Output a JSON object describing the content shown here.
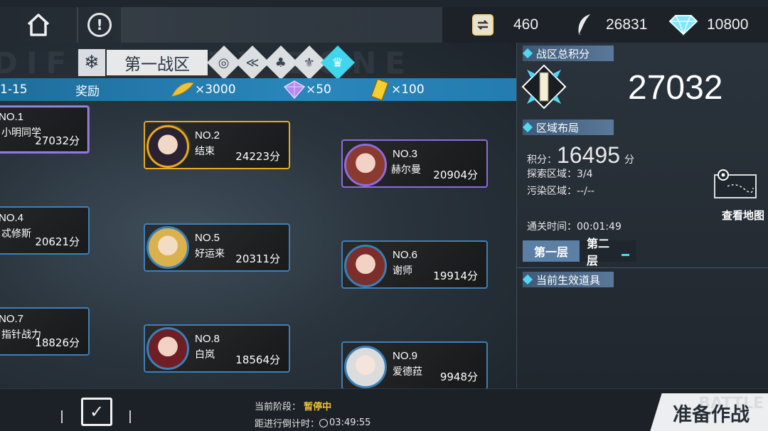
{
  "topbar": {
    "currencies": [
      {
        "icon": "exchange-ticket-icon",
        "value": "460"
      },
      {
        "icon": "feather-icon",
        "value": "26831"
      },
      {
        "icon": "diamond-icon",
        "value": "10800"
      }
    ]
  },
  "zone": {
    "bg_word": "DIFFICULTY ZONE",
    "name": "第一战区",
    "suits": [
      "target-icon",
      "wing-icon",
      "club-icon",
      "fleur-icon",
      "crown-icon"
    ],
    "active_suit": "crown-icon"
  },
  "reward_bar": {
    "range": "1-15",
    "label": "奖励",
    "items": [
      {
        "icon": "feather-icon",
        "amount": "×3000"
      },
      {
        "icon": "crystal-icon",
        "amount": "×50"
      },
      {
        "icon": "ticket-icon",
        "amount": "×100"
      }
    ]
  },
  "ranks": [
    {
      "no": "NO.1",
      "name": "小明同学",
      "score": "27032分"
    },
    {
      "no": "NO.2",
      "name": "结束",
      "score": "24223分"
    },
    {
      "no": "NO.3",
      "name": "赫尔曼",
      "score": "20904分"
    },
    {
      "no": "NO.4",
      "name": "忒修斯",
      "score": "20621分"
    },
    {
      "no": "NO.5",
      "name": "好运来",
      "score": "20311分"
    },
    {
      "no": "NO.6",
      "name": "谢师",
      "score": "19914分"
    },
    {
      "no": "NO.7",
      "name": "指针战力",
      "score": "18826分"
    },
    {
      "no": "NO.8",
      "name": "白岚",
      "score": "18564分"
    },
    {
      "no": "NO.9",
      "name": "爱德菈",
      "score": "9948分"
    }
  ],
  "panel": {
    "total_title": "战区总积分",
    "total_score": "27032",
    "layout_title": "区域布局",
    "score_label": "积分：",
    "score_value": "16495",
    "score_unit": "分",
    "explore": "探索区域：3/4",
    "pollute": "污染区域：--/--",
    "clear_time": "通关时间：00:01:49",
    "layer_tabs": [
      "第一层",
      "第二层"
    ],
    "map_label": "查看地图",
    "items_title": "当前生效道具"
  },
  "bottom": {
    "task_label": "任务",
    "stage_label": "当前阶段：",
    "stage_status": "暂停中",
    "countdown_label": "距进行倒计时：",
    "countdown": "03:49:55",
    "battle_label": "准备作战",
    "battle_bg": "BATTLE"
  },
  "colors": {
    "accent": "#4fd8f0",
    "gold": "#e8a822",
    "purple": "#8e6cd8",
    "blue": "#3f7fb5",
    "status": "#f3c13a"
  }
}
